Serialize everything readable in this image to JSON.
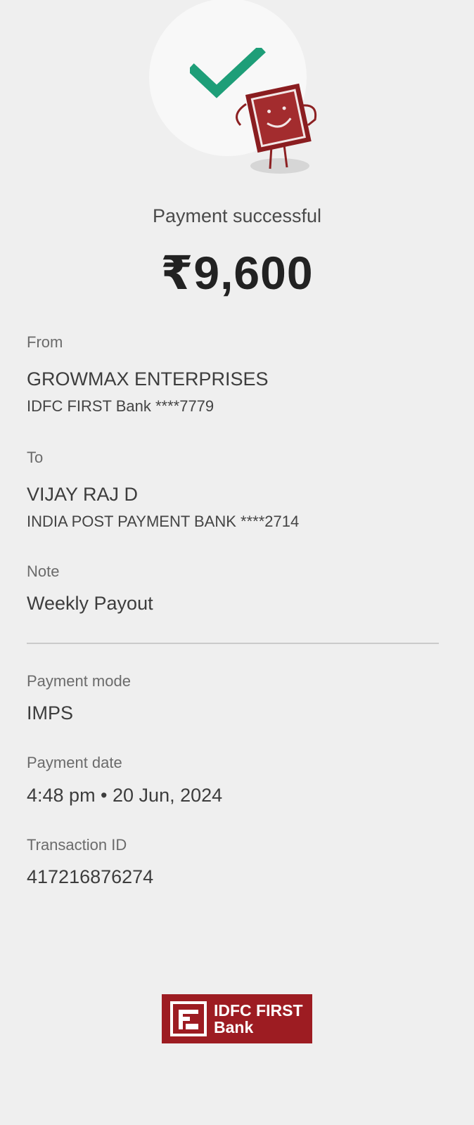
{
  "header": {
    "status": "Payment successful",
    "amount": "₹9,600"
  },
  "from": {
    "label": "From",
    "name": "GROWMAX ENTERPRISES",
    "account": "IDFC FIRST Bank ****7779"
  },
  "to": {
    "label": "To",
    "name": "VIJAY RAJ D",
    "account": "INDIA POST PAYMENT BANK ****2714"
  },
  "note": {
    "label": "Note",
    "value": "Weekly Payout"
  },
  "payment_mode": {
    "label": "Payment mode",
    "value": "IMPS"
  },
  "payment_date": {
    "label": "Payment date",
    "value": "4:48 pm • 20 Jun, 2024"
  },
  "transaction": {
    "label": "Transaction ID",
    "value": "417216876274"
  },
  "logo": {
    "line1": "IDFC FIRST",
    "line2": "Bank"
  },
  "colors": {
    "background": "#efefef",
    "check": "#1e9e78",
    "brand": "#9d1c22"
  },
  "icons": {
    "success": "checkmark-icon",
    "mascot": "smiling-card-mascot"
  }
}
